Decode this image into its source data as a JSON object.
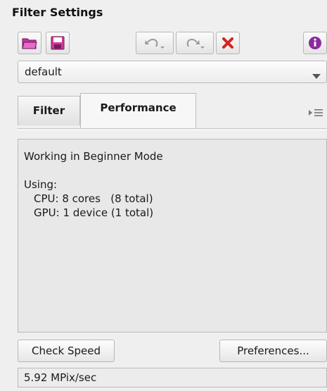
{
  "panel": {
    "title": "Filter Settings"
  },
  "toolbar": {
    "icons": [
      "open-folder-icon",
      "save-icon",
      "undo-icon",
      "redo-icon",
      "clear-icon",
      "info-icon"
    ],
    "colors": {
      "folder": "#cc2fa6",
      "save": "#d03a9a",
      "clear": "#d0261c",
      "info": "#8a2aa0"
    }
  },
  "preset": {
    "value": "default"
  },
  "tabs": [
    {
      "label": "Filter"
    },
    {
      "label": "Performance",
      "active": true
    }
  ],
  "performance": {
    "mode": "Working in Beginner Mode",
    "using_label": "Using:",
    "cpu": "CPU: 8 cores   (8 total)",
    "gpu": "GPU: 1 device (1 total)"
  },
  "buttons": {
    "check_speed": "Check Speed",
    "preferences": "Preferences..."
  },
  "status": {
    "speed": "5.92 MPix/sec"
  }
}
